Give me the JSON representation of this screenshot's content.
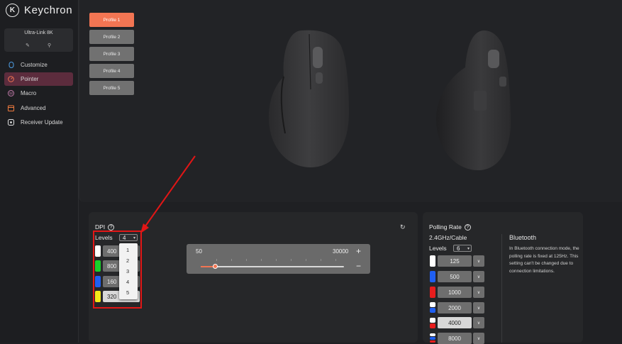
{
  "app": {
    "brand": "Keychron"
  },
  "device": {
    "name": "Ultra-Link 8K"
  },
  "nav": [
    {
      "label": "Customize",
      "icon": "mouse-icon"
    },
    {
      "label": "Pointer",
      "icon": "gauge-icon",
      "active": true
    },
    {
      "label": "Macro",
      "icon": "macro-m-icon"
    },
    {
      "label": "Advanced",
      "icon": "calendar-icon"
    },
    {
      "label": "Receiver Update",
      "icon": "receiver-icon"
    }
  ],
  "profiles": [
    "Profile 1",
    "Profile 2",
    "Profile 3",
    "Profile 4",
    "Profile 5"
  ],
  "dpi": {
    "title": "DPI",
    "levels_label": "Levels",
    "levels_value": "4",
    "rows": [
      "400",
      "800",
      "160",
      "320"
    ],
    "row_colors": [
      "#ffffff",
      "#19d12a",
      "#1f5ff2",
      "#f5e81a"
    ],
    "dropdown_options": [
      "1",
      "2",
      "3",
      "4",
      "5"
    ],
    "slider_min": "50",
    "slider_max": "30000",
    "slider_plus": "+",
    "slider_minus": "−",
    "slider_fraction": 0.1
  },
  "polling": {
    "title": "Polling Rate",
    "wired_label": "2.4GHz/Cable",
    "levels_label": "Levels",
    "levels_value": "6",
    "rates": [
      "125",
      "500",
      "1000",
      "2000",
      "4000",
      "8000"
    ],
    "bluetooth_title": "Bluetooth",
    "bluetooth_text": "In Bluetooth connection mode, the polling rate is fixed at 125Hz. This setting can't be changed due to connection limitations."
  },
  "colors": {
    "accent": "#f27553",
    "active_nav": "#5c2c3d",
    "annotation_red": "#e21616"
  }
}
